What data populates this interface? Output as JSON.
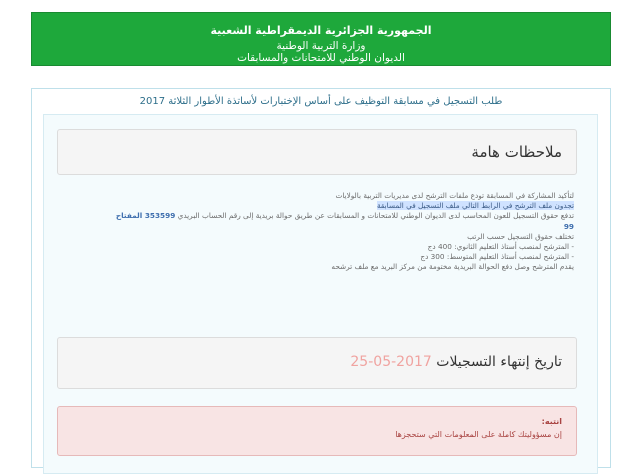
{
  "header": {
    "line1": "الجمهورية الجزائرية الديمقراطية الشعبية",
    "line2": "وزارة التربية الوطنية",
    "line3": "الديوان الوطني للامتحانات والمسابقات"
  },
  "panel": {
    "title": "طلب التسجيل في مسابقة التوظيف على أساس الإختبارات لأساتذة الأطوار الثلاثة 2017"
  },
  "notes": {
    "title": "ملاحظات هامة",
    "lines": [
      "لتأكيد المشاركة في المسابقة تودع ملفات الترشح لدى مديريات التربية بالولايات",
      "تجدون ملف الترشح في الرابط التالي ملف التسجيل في المسابقة",
      "تدفع حقوق التسجيل للعون المحاسب لدى الديوان الوطني للامتحانات و المسابقات عن طريق حوالة بريدية إلى رقم الحساب البريدي",
      "99",
      "تختلف حقوق التسجيل حسب الرتب",
      "- المترشح لمنصب أستاذ التعليم الثانوي: 400 دج",
      "- المترشح لمنصب أستاذ التعليم المتوسط: 300 دج",
      "يقدم المترشح وصل دفع الحوالة البريدية مختومة من مركز البريد مع ملف ترشحه"
    ],
    "account": "353599 المفتاح"
  },
  "deadline": {
    "label": "تاريخ إنتهاء التسجيلات",
    "date": "2017-05-25"
  },
  "alert": {
    "title": "انتبه:",
    "text": "إن مسؤوليتك كاملة على المعلومات التي ستحجزها"
  }
}
